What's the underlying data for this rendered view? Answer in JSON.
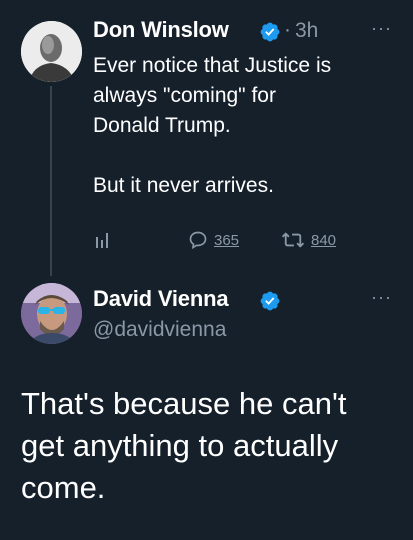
{
  "tweet1": {
    "author_name": "Don Winslow",
    "separator": "·",
    "time": "3h",
    "more": "···",
    "text": "Ever notice that Justice is\nalways \"coming\" for\nDonald Trump.\n\nBut it never arrives.",
    "replies": "365",
    "retweets": "840",
    "icons": {
      "analytics": "bar-chart-icon",
      "reply": "reply-icon",
      "retweet": "retweet-icon",
      "verified": "verified-badge-icon"
    }
  },
  "tweet2": {
    "author_name": "David Vienna",
    "handle": "@davidvienna",
    "more": "···",
    "text": "That's because he can't\nget anything to actually\ncome."
  },
  "colors": {
    "background": "#15202b",
    "text": "#ffffff",
    "muted": "#8b98a5",
    "verified": "#1d9bf0",
    "thread_line": "#38444d"
  }
}
